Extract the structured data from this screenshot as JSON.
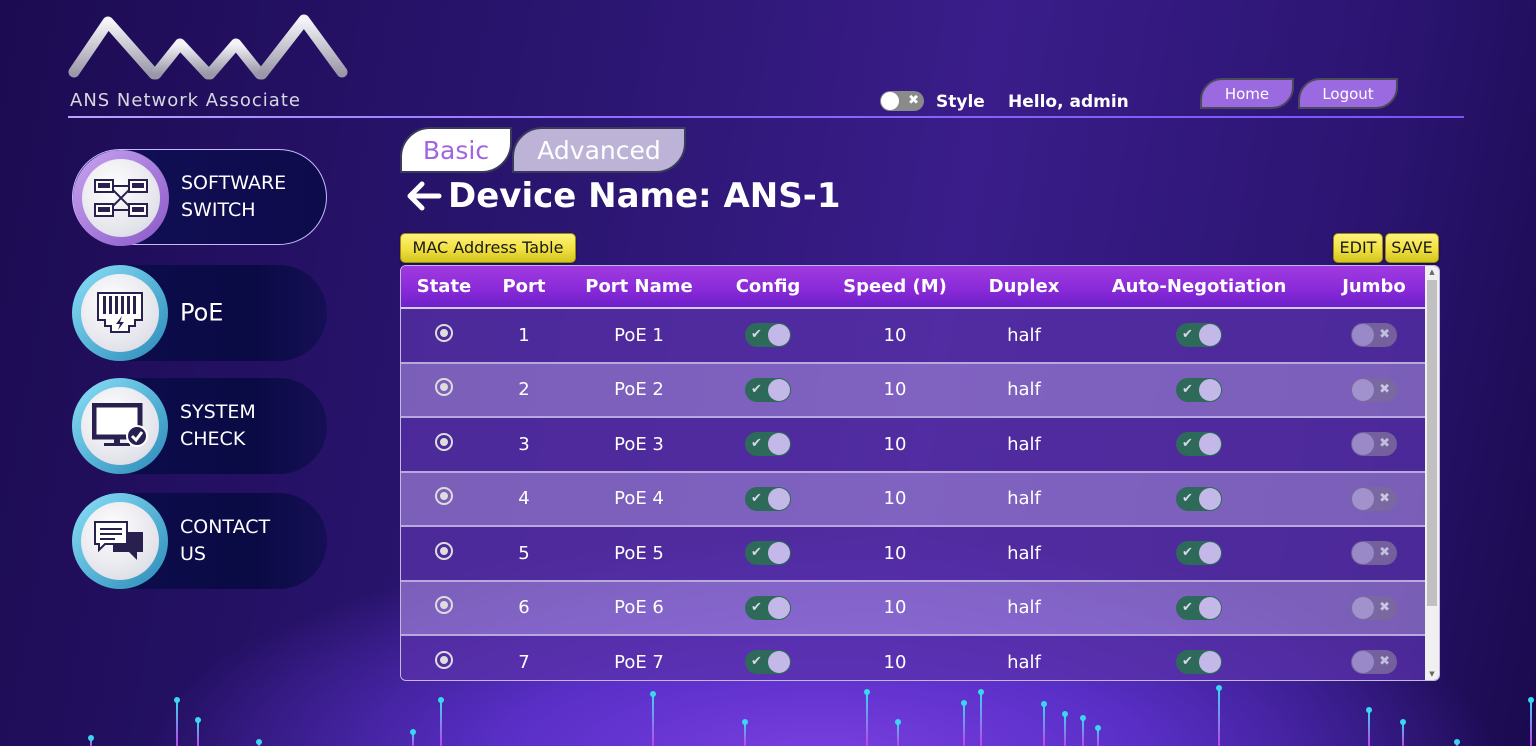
{
  "brand": {
    "name": "ANS Network Associate"
  },
  "header": {
    "style_toggle_label": "Style",
    "style_toggle_glyph": "✖",
    "greeting": "Hello, admin",
    "home_label": "Home",
    "logout_label": "Logout"
  },
  "sidebar": {
    "items": [
      {
        "label_line1": "SOFTWARE",
        "label_line2": "SWITCH",
        "icon": "switch-icon",
        "active": true
      },
      {
        "label_line1": "PoE",
        "label_line2": "",
        "icon": "ethernet-power-icon",
        "active": false
      },
      {
        "label_line1": "SYSTEM",
        "label_line2": "CHECK",
        "icon": "monitor-check-icon",
        "active": false
      },
      {
        "label_line1": "CONTACT",
        "label_line2": "US",
        "icon": "chat-icon",
        "active": false
      }
    ]
  },
  "tabs": [
    {
      "label": "Basic",
      "selected": true
    },
    {
      "label": "Advanced",
      "selected": false
    }
  ],
  "page": {
    "back_glyph": "🡐",
    "title": "Device Name: ANS-1",
    "mac_button": "MAC Address Table",
    "edit_button": "EDIT",
    "save_button": "SAVE"
  },
  "table": {
    "columns": [
      "State",
      "Port",
      "Port Name",
      "Config",
      "Speed (M)",
      "Duplex",
      "Auto-Negotiation",
      "Jumbo"
    ],
    "rows": [
      {
        "port": "1",
        "name": "PoE 1",
        "config": true,
        "speed": "10",
        "duplex": "half",
        "autoneg": true,
        "jumbo": false
      },
      {
        "port": "2",
        "name": "PoE 2",
        "config": true,
        "speed": "10",
        "duplex": "half",
        "autoneg": true,
        "jumbo": false
      },
      {
        "port": "3",
        "name": "PoE 3",
        "config": true,
        "speed": "10",
        "duplex": "half",
        "autoneg": true,
        "jumbo": false
      },
      {
        "port": "4",
        "name": "PoE 4",
        "config": true,
        "speed": "10",
        "duplex": "half",
        "autoneg": true,
        "jumbo": false
      },
      {
        "port": "5",
        "name": "PoE 5",
        "config": true,
        "speed": "10",
        "duplex": "half",
        "autoneg": true,
        "jumbo": false
      },
      {
        "port": "6",
        "name": "PoE 6",
        "config": true,
        "speed": "10",
        "duplex": "half",
        "autoneg": true,
        "jumbo": false
      },
      {
        "port": "7",
        "name": "PoE 7",
        "config": true,
        "speed": "10",
        "duplex": "half",
        "autoneg": true,
        "jumbo": false
      }
    ],
    "on_glyph": "✔",
    "off_glyph": "✖"
  },
  "colors": {
    "accent": "#9b6ae0",
    "header_row": "#8a2ad8",
    "toggle_on": "#2e6a5a",
    "button_yellow": "#f0e040"
  }
}
